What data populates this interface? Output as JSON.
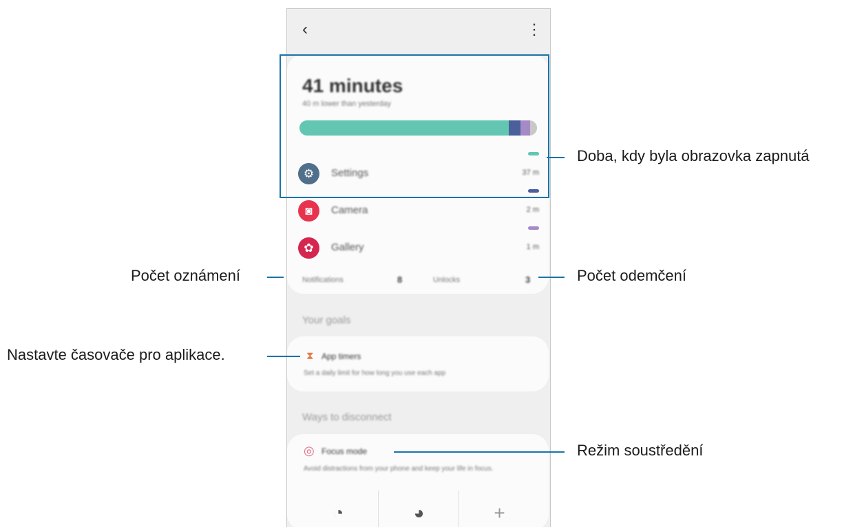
{
  "phone": {
    "back_icon": "‹",
    "more_icon": "⋮",
    "screen_time": {
      "total": "41 minutes",
      "subtitle": "40 m lower than yesterday",
      "bar_segments": [
        {
          "fraction": 0.88,
          "color": "#62c6b3"
        },
        {
          "fraction": 0.05,
          "color": "#4a5f9c"
        },
        {
          "fraction": 0.04,
          "color": "#a58ac6"
        },
        {
          "fraction": 0.03,
          "color": "#c8c8c8"
        }
      ],
      "apps": [
        {
          "name": "Settings",
          "time": "37 m",
          "icon": "gear-icon",
          "glyph": "⚙",
          "icon_color": "#4f6f8a",
          "dash_color": "#62c6b3"
        },
        {
          "name": "Camera",
          "time": "2 m",
          "icon": "camera-icon",
          "glyph": "◙",
          "icon_color": "#e8334f",
          "dash_color": "#4a5f9c"
        },
        {
          "name": "Gallery",
          "time": "1 m",
          "icon": "flower-icon",
          "glyph": "✿",
          "icon_color": "#d4264f",
          "dash_color": "#a58ac6"
        }
      ]
    },
    "stats": {
      "notifications_label": "Notifications",
      "notifications_value": "8",
      "unlocks_label": "Unlocks",
      "unlocks_value": "3"
    },
    "goals": {
      "title": "Your goals",
      "app_timers_icon": "hourglass-icon",
      "app_timers_glyph": "⧗",
      "app_timers_label": "App timers",
      "app_timers_desc": "Set a daily limit for how long you use each app"
    },
    "disconnect": {
      "title": "Ways to disconnect",
      "focus_icon": "target-icon",
      "focus_glyph": "◎",
      "focus_label": "Focus mode",
      "focus_desc": "Avoid distractions from your phone and keep your life in focus.",
      "buttons": [
        {
          "icon": "work-focus-icon",
          "glyph": "◔"
        },
        {
          "icon": "relax-focus-icon",
          "glyph": "◕"
        },
        {
          "icon": "add-icon",
          "glyph": "+"
        }
      ]
    }
  },
  "annotations": {
    "screen_on": "Doba, kdy byla obrazovka zapnutá",
    "notifications": "Počet oznámení",
    "unlocks": "Počet odemčení",
    "app_timers": "Nastavte časovače pro aplikace.",
    "focus_mode": "Režim soustředění"
  },
  "colors": {
    "callout_line": "#1a73a8",
    "accent_focus": "#e26a86",
    "accent_timer": "#e57a46"
  }
}
